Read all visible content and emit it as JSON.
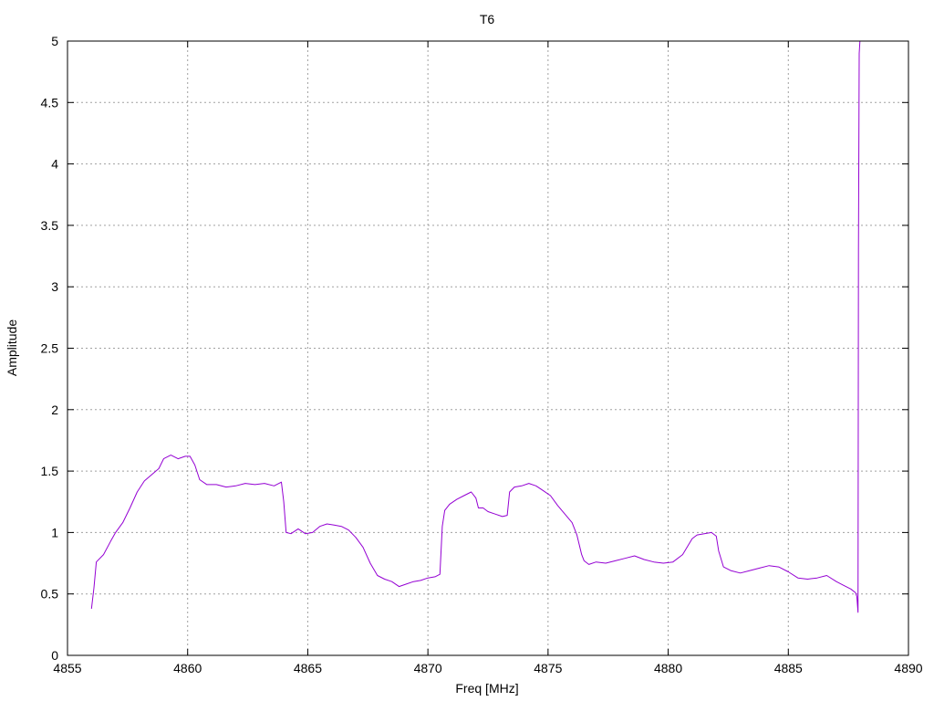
{
  "chart_data": {
    "type": "line",
    "title": "T6",
    "xlabel": "Freq [MHz]",
    "ylabel": "Amplitude",
    "xlim": [
      4855,
      4890
    ],
    "ylim": [
      0,
      5
    ],
    "xticks": [
      4855,
      4860,
      4865,
      4870,
      4875,
      4880,
      4885,
      4890
    ],
    "yticks": [
      0,
      0.5,
      1,
      1.5,
      2,
      2.5,
      3,
      3.5,
      4,
      4.5,
      5
    ],
    "ytick_labels": [
      "0",
      "0.5",
      "1",
      "1.5",
      "2",
      "2.5",
      "3",
      "3.5",
      "4",
      "4.5",
      "5"
    ],
    "grid": true,
    "legend": false,
    "color": "#9400d3",
    "series": [
      {
        "x": [
          4856.0,
          4856.1,
          4856.2,
          4856.5,
          4856.8,
          4857.0,
          4857.3,
          4857.6,
          4857.9,
          4858.2,
          4858.5,
          4858.8,
          4859.0,
          4859.3,
          4859.6,
          4859.9,
          4860.1,
          4860.3,
          4860.5,
          4860.8,
          4861.2,
          4861.6,
          4862.0,
          4862.4,
          4862.8,
          4863.2,
          4863.6,
          4863.9,
          4864.0,
          4864.1,
          4864.3,
          4864.6,
          4864.9,
          4865.2,
          4865.5,
          4865.8,
          4866.1,
          4866.4,
          4866.7,
          4867.0,
          4867.3,
          4867.6,
          4867.9,
          4868.2,
          4868.5,
          4868.8,
          4869.1,
          4869.4,
          4869.7,
          4870.0,
          4870.3,
          4870.5,
          4870.6,
          4870.7,
          4870.9,
          4871.2,
          4871.5,
          4871.8,
          4872.0,
          4872.1,
          4872.3,
          4872.5,
          4872.8,
          4873.1,
          4873.3,
          4873.4,
          4873.6,
          4873.9,
          4874.2,
          4874.5,
          4874.8,
          4875.1,
          4875.4,
          4875.7,
          4876.0,
          4876.2,
          4876.4,
          4876.5,
          4876.7,
          4877.0,
          4877.4,
          4877.8,
          4878.2,
          4878.6,
          4879.0,
          4879.4,
          4879.8,
          4880.2,
          4880.6,
          4881.0,
          4881.2,
          4881.5,
          4881.8,
          4882.0,
          4882.1,
          4882.3,
          4882.6,
          4883.0,
          4883.4,
          4883.8,
          4884.2,
          4884.6,
          4885.0,
          4885.4,
          4885.8,
          4886.2,
          4886.6,
          4887.0,
          4887.3,
          4887.6,
          4887.8,
          4887.85,
          4887.9,
          4887.92,
          4887.95,
          4887.98
        ],
        "y": [
          0.38,
          0.55,
          0.76,
          0.82,
          0.93,
          1.0,
          1.08,
          1.2,
          1.33,
          1.42,
          1.47,
          1.52,
          1.6,
          1.63,
          1.6,
          1.62,
          1.62,
          1.55,
          1.43,
          1.39,
          1.39,
          1.37,
          1.38,
          1.4,
          1.39,
          1.4,
          1.38,
          1.41,
          1.25,
          1.0,
          0.99,
          1.03,
          0.99,
          1.0,
          1.05,
          1.07,
          1.06,
          1.05,
          1.02,
          0.96,
          0.88,
          0.75,
          0.65,
          0.62,
          0.6,
          0.56,
          0.58,
          0.6,
          0.61,
          0.63,
          0.64,
          0.66,
          1.05,
          1.18,
          1.23,
          1.27,
          1.3,
          1.33,
          1.28,
          1.2,
          1.2,
          1.17,
          1.15,
          1.13,
          1.14,
          1.33,
          1.37,
          1.38,
          1.4,
          1.38,
          1.34,
          1.3,
          1.22,
          1.15,
          1.08,
          0.98,
          0.82,
          0.77,
          0.74,
          0.76,
          0.75,
          0.77,
          0.79,
          0.81,
          0.78,
          0.76,
          0.75,
          0.76,
          0.82,
          0.95,
          0.98,
          0.99,
          1.0,
          0.97,
          0.85,
          0.72,
          0.69,
          0.67,
          0.69,
          0.71,
          0.73,
          0.72,
          0.68,
          0.63,
          0.62,
          0.63,
          0.65,
          0.6,
          0.57,
          0.54,
          0.51,
          0.48,
          0.35,
          3.3,
          4.9,
          5.0
        ]
      }
    ]
  }
}
